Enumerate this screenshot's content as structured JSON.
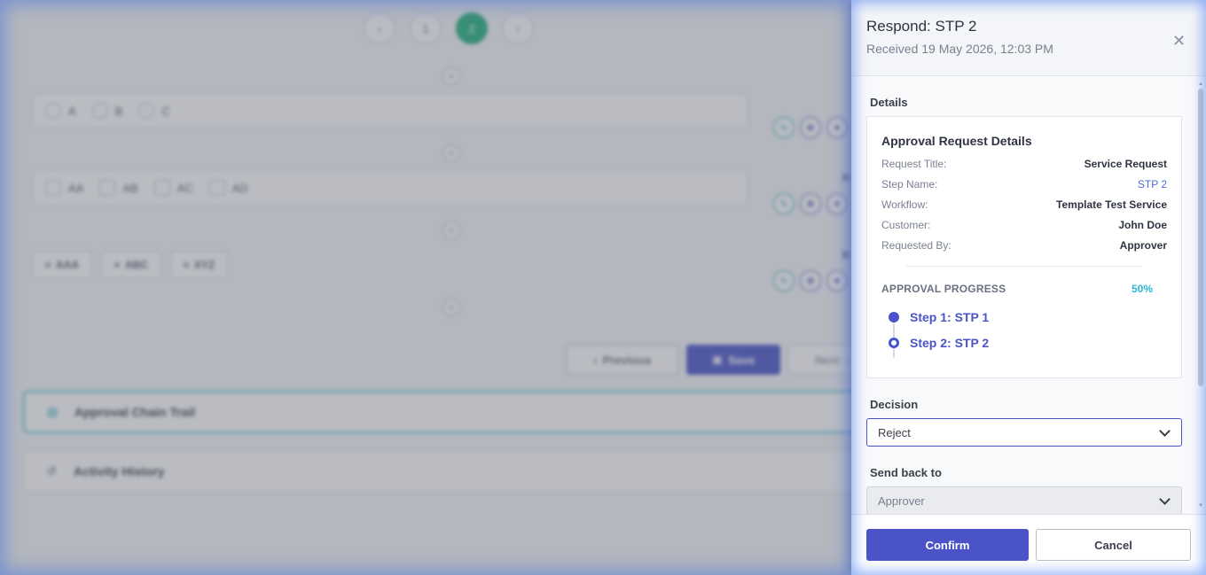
{
  "background": {
    "pager": {
      "prev_icon": "chevron-left-icon",
      "pages": [
        "1",
        "2"
      ],
      "active_page": "2",
      "next_icon": "chevron-right-icon"
    },
    "radio_options": [
      "A",
      "B",
      "C"
    ],
    "checkbox_options": [
      "AA",
      "AB",
      "AC",
      "AD"
    ],
    "chips": [
      "AAA",
      "ABC",
      "XYZ"
    ],
    "row_labels": [
      "R",
      "R"
    ],
    "buttons": {
      "previous": "Previous",
      "save": "Save",
      "next": "Next"
    },
    "accordions": {
      "approval_chain": "Approval Chain Trail",
      "activity_history": "Activity History"
    }
  },
  "panel": {
    "title": "Respond: STP 2",
    "received": "Received 19 May 2026, 12:03 PM",
    "details_label": "Details",
    "card": {
      "title": "Approval Request Details",
      "fields": [
        {
          "key": "Request Title:",
          "value": "Service Request"
        },
        {
          "key": "Step Name:",
          "value": "STP 2"
        },
        {
          "key": "Workflow:",
          "value": "Template Test Service"
        },
        {
          "key": "Customer:",
          "value": "John Doe"
        },
        {
          "key": "Requested By:",
          "value": "Approver"
        }
      ],
      "progress_label": "APPROVAL PROGRESS",
      "progress_percent": "50%",
      "steps": [
        "Step 1: STP 1",
        "Step 2: STP 2"
      ]
    },
    "decision": {
      "label": "Decision",
      "value": "Reject"
    },
    "send_back": {
      "label": "Send back to",
      "value": "Approver"
    },
    "confirm_label": "Confirm",
    "cancel_label": "Cancel"
  },
  "colors": {
    "accent": "#4a54c8",
    "teal": "#2ab8d0",
    "active_page": "#22b07d"
  }
}
